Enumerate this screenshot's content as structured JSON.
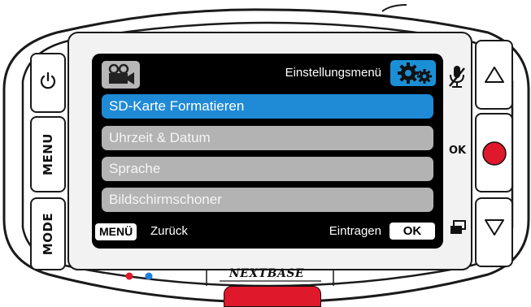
{
  "device": {
    "brand": "NEXTBASE",
    "left_buttons": [
      "MENU",
      "MODE"
    ],
    "right_ok_label": "OK",
    "record_color": "#e0182b",
    "led_colors": [
      "#e0182b",
      "#1f7fe0"
    ]
  },
  "screen": {
    "title": "Einstellungsmenü",
    "tabs": [
      {
        "icon": "video-camera-icon",
        "selected": false
      },
      {
        "icon": "gears-camera-icon",
        "selected": true
      }
    ],
    "menu_items": [
      {
        "label": "SD-Karte Formatieren",
        "selected": true
      },
      {
        "label": "Uhrzeit & Datum",
        "selected": false
      },
      {
        "label": "Sprache",
        "selected": false
      },
      {
        "label": "Bildschirmschoner",
        "selected": false
      }
    ],
    "footer": {
      "menu_key": "MENÜ",
      "back_label": "Zurück",
      "enter_label": "Eintragen",
      "ok_key": "OK"
    },
    "accent_color": "#1f8ad6"
  }
}
